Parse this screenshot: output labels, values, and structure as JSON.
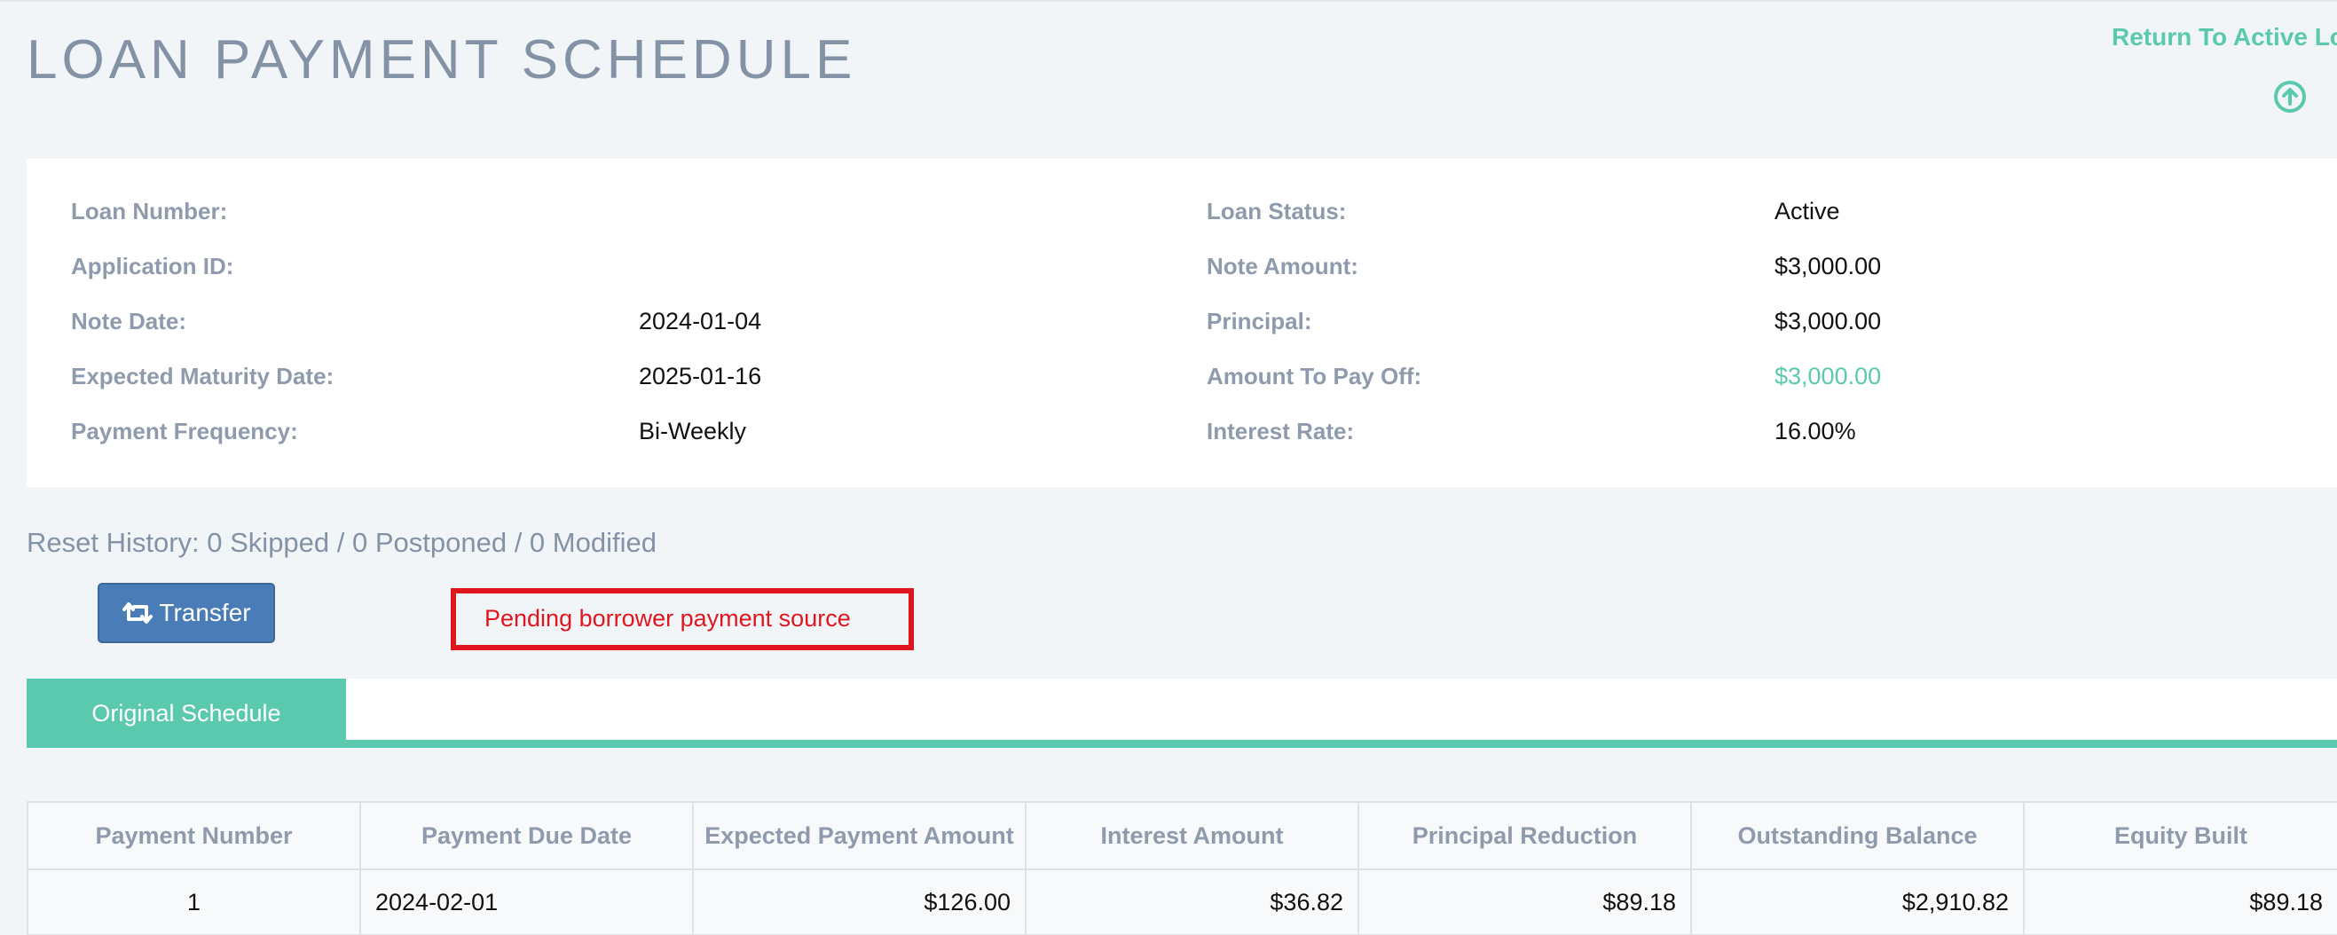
{
  "header": {
    "title": "LOAN PAYMENT SCHEDULE",
    "return_link": "Return To Active Loans",
    "upload_icon": "circle-arrow-up-icon",
    "accent_color": "#5bc9ae"
  },
  "loan_info": {
    "left": [
      {
        "label": "Loan Number:",
        "value": ""
      },
      {
        "label": "Application ID:",
        "value": ""
      },
      {
        "label": "Note Date:",
        "value": "2024-01-04"
      },
      {
        "label": "Expected Maturity Date:",
        "value": "2025-01-16"
      },
      {
        "label": "Payment Frequency:",
        "value": "Bi-Weekly"
      }
    ],
    "right": [
      {
        "label": "Loan Status:",
        "value": "Active"
      },
      {
        "label": "Note Amount:",
        "value": "$3,000.00"
      },
      {
        "label": "Principal:",
        "value": "$3,000.00"
      },
      {
        "label": "Amount To Pay Off:",
        "value": "$3,000.00"
      },
      {
        "label": "Interest Rate:",
        "value": "16.00%"
      }
    ]
  },
  "reset_history": "Reset History: 0 Skipped / 0 Postponed / 0 Modified",
  "actions": {
    "transfer_label": "Transfer",
    "transfer_icon": "retweet-icon",
    "button_color": "#4a7db8",
    "pending_message": "Pending borrower payment source",
    "pending_color": "#e0161e"
  },
  "tabs": [
    {
      "label": "Original Schedule",
      "active": true
    }
  ],
  "table": {
    "columns": [
      "Payment Number",
      "Payment Due Date",
      "Expected Payment Amount",
      "Interest Amount",
      "Principal Reduction",
      "Outstanding Balance",
      "Equity Built"
    ],
    "rows": [
      [
        "1",
        "2024-02-01",
        "$126.00",
        "$36.82",
        "$89.18",
        "$2,910.82",
        "$89.18"
      ]
    ]
  }
}
